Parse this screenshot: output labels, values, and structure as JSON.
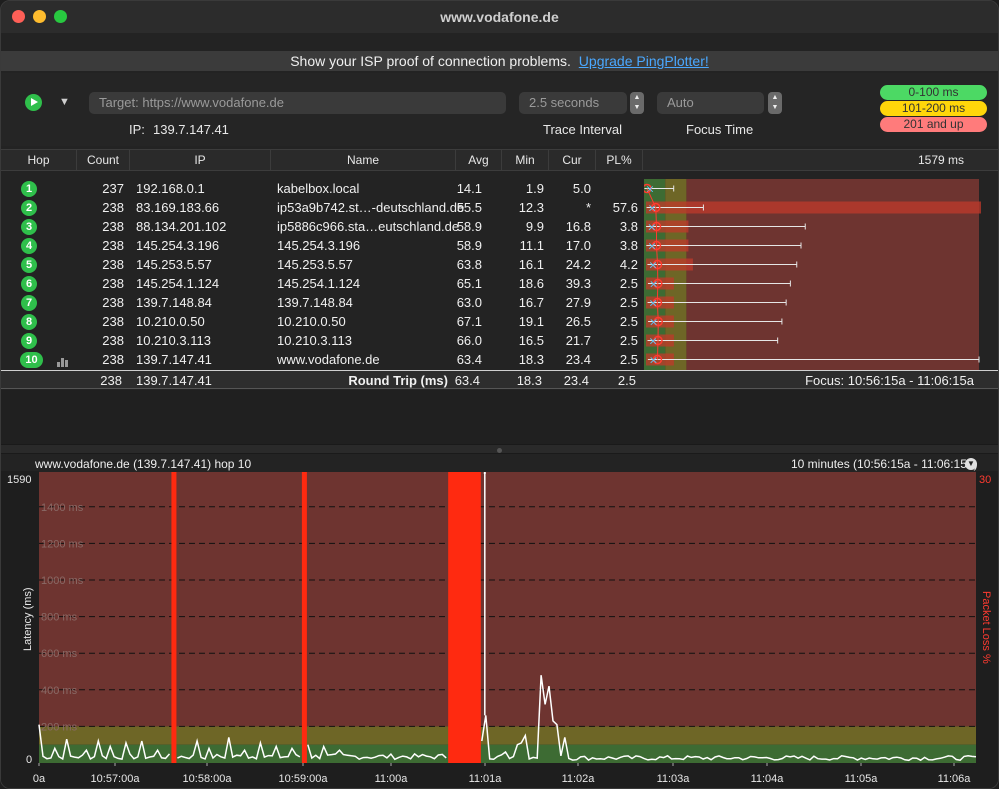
{
  "window": {
    "title": "www.vodafone.de"
  },
  "banner": {
    "text": "Show your ISP proof of connection problems.",
    "link": "Upgrade PingPlotter!"
  },
  "toolbar": {
    "target_placeholder": "Target:  https://www.vodafone.de",
    "ip_label": "IP:",
    "ip_value": "139.7.147.41",
    "trace_interval_value": "2.5 seconds",
    "trace_interval_label": "Trace Interval",
    "focus_time_value": "Auto",
    "focus_time_label": "Focus Time"
  },
  "latency_legend": [
    {
      "label": "0-100 ms",
      "color": "#4cd964"
    },
    {
      "label": "101-200 ms",
      "color": "#ffd60a"
    },
    {
      "label": "201 and up",
      "color": "#ff7b7b"
    }
  ],
  "table": {
    "headers": {
      "hop": "Hop",
      "count": "Count",
      "ip": "IP",
      "name": "Name",
      "avg": "Avg",
      "min": "Min",
      "cur": "Cur",
      "pl": "PL%",
      "scale": "1579 ms"
    },
    "rows": [
      {
        "hop": "1",
        "count": "237",
        "ip": "192.168.0.1",
        "name": "kabelbox.local",
        "avg": "14.1",
        "min": "1.9",
        "cur": "5.0",
        "pl": "",
        "avg_ms": 14.1,
        "min_ms": 1.9,
        "max_ms": 140,
        "pl_value": 0
      },
      {
        "hop": "2",
        "count": "238",
        "ip": "83.169.183.66",
        "name": "ip53a9b742.st…-deutschland.de",
        "avg": "55.5",
        "min": "12.3",
        "cur": "*",
        "pl": "57.6",
        "avg_ms": 55.5,
        "min_ms": 12.3,
        "max_ms": 280,
        "pl_value": 57.6
      },
      {
        "hop": "3",
        "count": "238",
        "ip": "88.134.201.102",
        "name": "ip5886c966.sta…eutschland.de",
        "avg": "58.9",
        "min": "9.9",
        "cur": "16.8",
        "pl": "3.8",
        "avg_ms": 58.9,
        "min_ms": 9.9,
        "max_ms": 760,
        "pl_value": 3.8
      },
      {
        "hop": "4",
        "count": "238",
        "ip": "145.254.3.196",
        "name": "145.254.3.196",
        "avg": "58.9",
        "min": "11.1",
        "cur": "17.0",
        "pl": "3.8",
        "avg_ms": 58.9,
        "min_ms": 11.1,
        "max_ms": 740,
        "pl_value": 3.8
      },
      {
        "hop": "5",
        "count": "238",
        "ip": "145.253.5.57",
        "name": "145.253.5.57",
        "avg": "63.8",
        "min": "16.1",
        "cur": "24.2",
        "pl": "4.2",
        "avg_ms": 63.8,
        "min_ms": 16.1,
        "max_ms": 720,
        "pl_value": 4.2
      },
      {
        "hop": "6",
        "count": "238",
        "ip": "145.254.1.124",
        "name": "145.254.1.124",
        "avg": "65.1",
        "min": "18.6",
        "cur": "39.3",
        "pl": "2.5",
        "avg_ms": 65.1,
        "min_ms": 18.6,
        "max_ms": 690,
        "pl_value": 2.5
      },
      {
        "hop": "7",
        "count": "238",
        "ip": "139.7.148.84",
        "name": "139.7.148.84",
        "avg": "63.0",
        "min": "16.7",
        "cur": "27.9",
        "pl": "2.5",
        "avg_ms": 63.0,
        "min_ms": 16.7,
        "max_ms": 670,
        "pl_value": 2.5
      },
      {
        "hop": "8",
        "count": "238",
        "ip": "10.210.0.50",
        "name": "10.210.0.50",
        "avg": "67.1",
        "min": "19.1",
        "cur": "26.5",
        "pl": "2.5",
        "avg_ms": 67.1,
        "min_ms": 19.1,
        "max_ms": 650,
        "pl_value": 2.5
      },
      {
        "hop": "9",
        "count": "238",
        "ip": "10.210.3.113",
        "name": "10.210.3.113",
        "avg": "66.0",
        "min": "16.5",
        "cur": "21.7",
        "pl": "2.5",
        "avg_ms": 66.0,
        "min_ms": 16.5,
        "max_ms": 630,
        "pl_value": 2.5
      },
      {
        "hop": "10",
        "count": "238",
        "ip": "139.7.147.41",
        "name": "www.vodafone.de",
        "avg": "63.4",
        "min": "18.3",
        "cur": "23.4",
        "pl": "2.5",
        "avg_ms": 63.4,
        "min_ms": 18.3,
        "max_ms": 1579,
        "pl_value": 2.5
      }
    ],
    "summary": {
      "count": "238",
      "ip": "139.7.147.41",
      "label": "Round Trip (ms)",
      "avg": "63.4",
      "min": "18.3",
      "cur": "23.4",
      "pl": "2.5",
      "focus": "Focus: 10:56:15a - 11:06:15a"
    }
  },
  "graph": {
    "title": "www.vodafone.de (139.7.147.41) hop 10",
    "range": "10 minutes (10:56:15a - 11:06:15a)",
    "y_left_label": "Latency (ms)",
    "y_right_label": "Packet Loss %",
    "y_top": "1590",
    "y_zero": "0",
    "y_right_top": "30",
    "gridlines": [
      "1400 ms",
      "1200 ms",
      "1000 ms",
      "800 ms",
      "600 ms",
      "400 ms",
      "200 ms"
    ],
    "x_ticks": [
      "0a",
      "10:57:00a",
      "10:58:00a",
      "10:59:00a",
      "11:00a",
      "11:01a",
      "11:02a",
      "11:03a",
      "11:04a",
      "11:05a",
      "11:06a"
    ],
    "colors": {
      "good": "#3d6b33",
      "warn": "#6e6626",
      "bad": "#6e3430",
      "loss": "#ff2a10",
      "line": "#ffffff"
    }
  }
}
